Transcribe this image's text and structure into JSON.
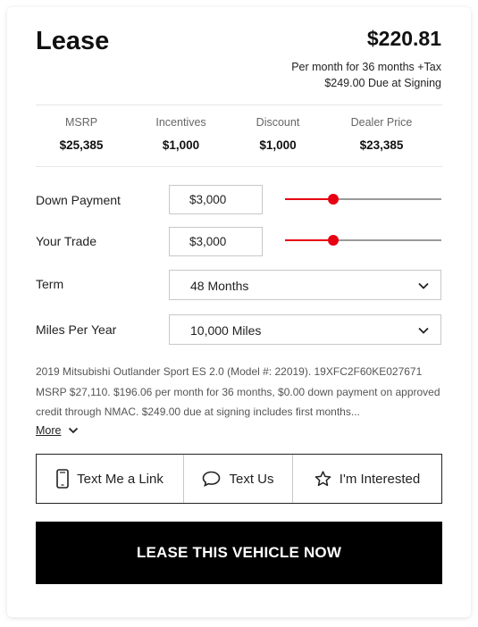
{
  "header": {
    "title": "Lease",
    "price": "$220.81",
    "price_line1": "Per month for 36 months +Tax",
    "price_line2": "$249.00 Due at Signing"
  },
  "stats": [
    {
      "label": "MSRP",
      "value": "$25,385"
    },
    {
      "label": "Incentives",
      "value": "$1,000"
    },
    {
      "label": "Discount",
      "value": "$1,000"
    },
    {
      "label": "Dealer Price",
      "value": "$23,385"
    }
  ],
  "down_payment": {
    "label": "Down Payment",
    "value": "$3,000",
    "slider_level": 0.31
  },
  "trade": {
    "label": "Your Trade",
    "value": "$3,000",
    "slider_level": 0.31
  },
  "term": {
    "label": "Term",
    "value": "48 Months"
  },
  "miles": {
    "label": "Miles Per Year",
    "value": "10,000 Miles"
  },
  "disclaimer": "2019 Mitsubishi Outlander Sport ES 2.0 (Model #: 22019). 19XFC2F60KE027671 MSRP $27,110. $196.06 per month for 36 months, $0.00 down payment on approved credit through NMAC. $249.00 due at signing includes first months...",
  "more_label": "More",
  "actions": {
    "text_link": "Text Me a Link",
    "text_us": "Text Us",
    "interested": "I'm Interested"
  },
  "cta_label": "LEASE THIS VEHICLE NOW",
  "colors": {
    "accent": "#e60012",
    "cta_bg": "#000000"
  }
}
